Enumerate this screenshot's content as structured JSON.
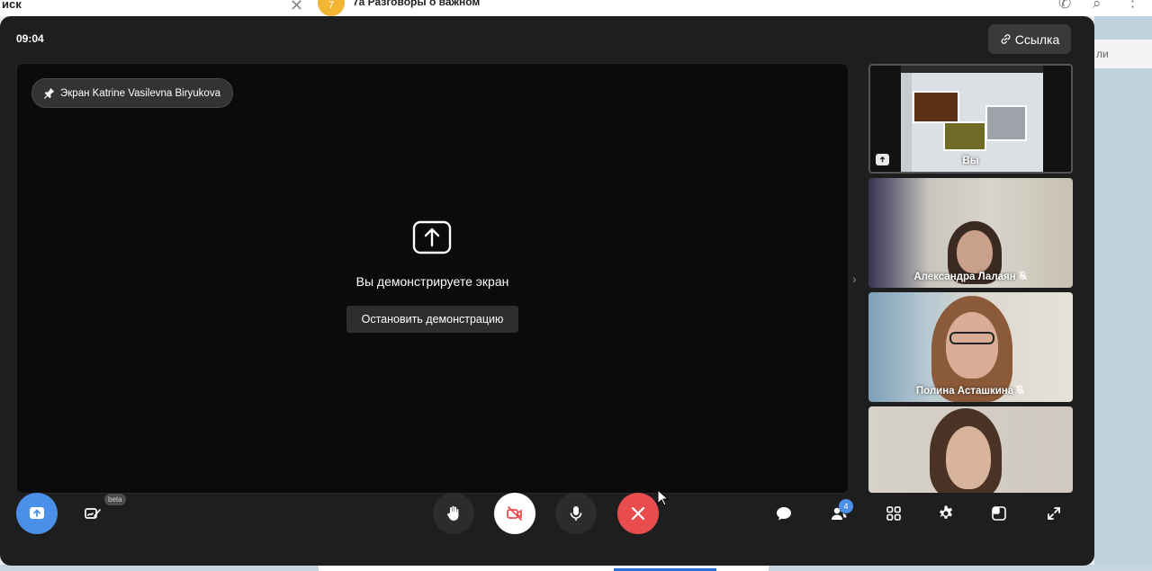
{
  "background": {
    "search_label": "иск",
    "chat_avatar_text": "7",
    "chat_title": "7а Разговоры о важном",
    "right_panel_text": "ли"
  },
  "call": {
    "timer": "09:04",
    "link_button_label": "Ссылка",
    "pinned_chip_label": "Экран Katrine Vasilevna Biryukova",
    "sharing_message": "Вы демонстрируете экран",
    "stop_button_label": "Остановить демонстрацию"
  },
  "participants": [
    {
      "name": "Вы",
      "muted": false
    },
    {
      "name": "Александра Лалаян",
      "muted": true
    },
    {
      "name": "Полина Асташкина",
      "muted": true
    },
    {
      "name": "",
      "muted": false
    }
  ],
  "controls": {
    "beta_label": "beta",
    "people_count": "4"
  },
  "colors": {
    "share_button": "#4a8fe8",
    "end_call": "#e94c4c",
    "window_bg": "#1e1e1e"
  }
}
